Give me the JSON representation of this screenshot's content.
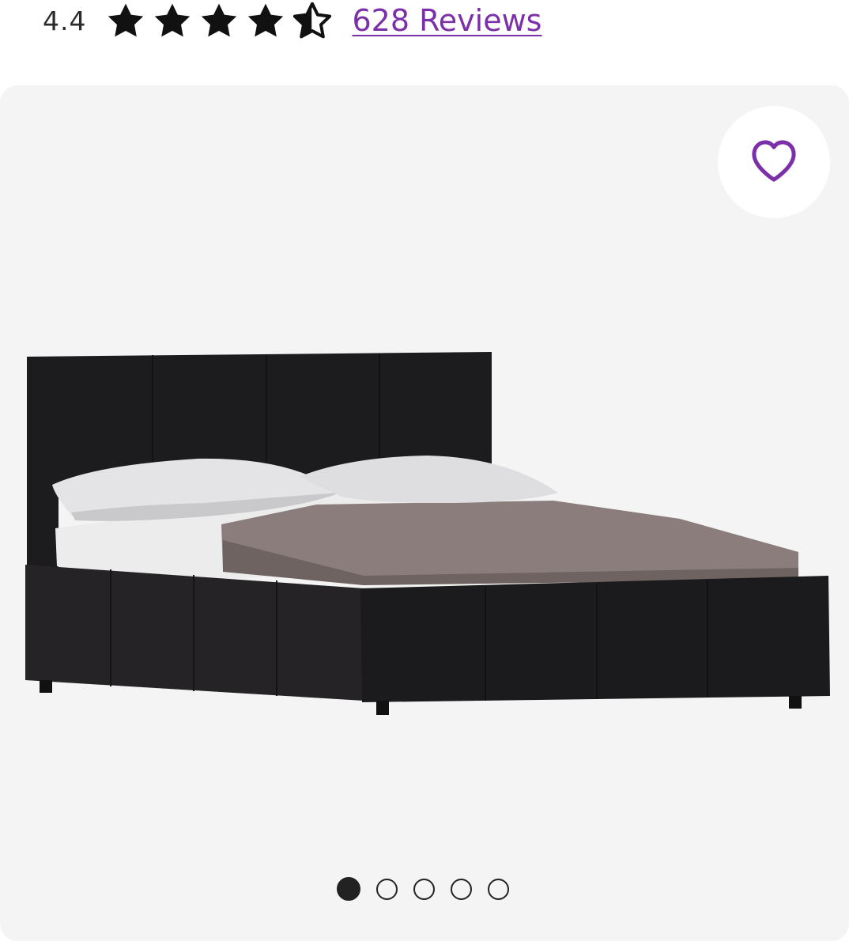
{
  "rating": {
    "value": "4.4",
    "stars_filled": 4.4,
    "stars_total": 5,
    "reviews_label": "628 Reviews"
  },
  "gallery": {
    "image_subject": "platform-bed-icon",
    "favorite_icon": "heart-outline-icon",
    "accent_color": "#7b2fa8",
    "total_images": 5,
    "active_index": 1
  }
}
